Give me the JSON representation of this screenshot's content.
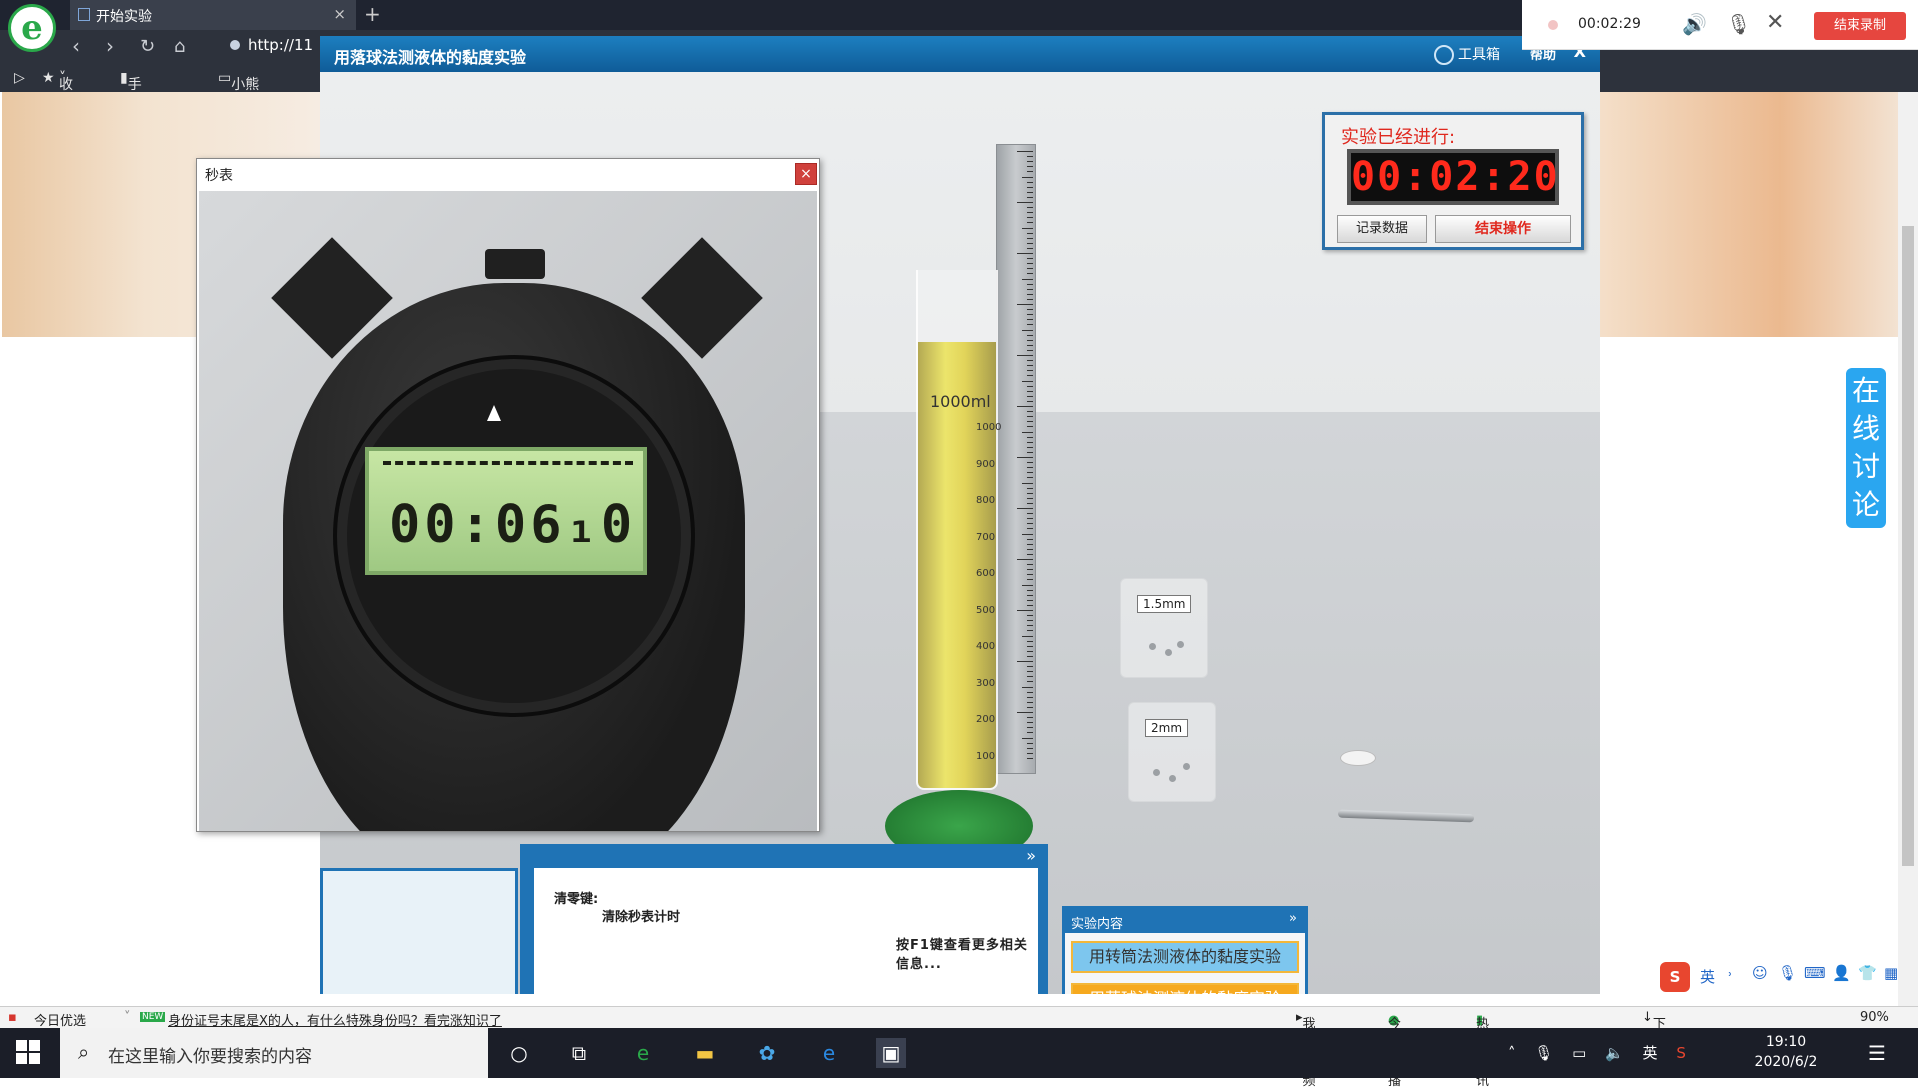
{
  "browser": {
    "tab_title": "开始实验",
    "address": "http://11",
    "bookmarks": [
      "收藏",
      "手机收藏夹",
      "小熊padd"
    ]
  },
  "app": {
    "title": "用落球法测液体的黏度实验",
    "toolbox_label": "工具箱",
    "help_label": "帮助",
    "close_label": "X"
  },
  "timer": {
    "label": "实验已经进行:",
    "display": "00:02:20",
    "record_button": "记录数据",
    "end_button": "结束操作"
  },
  "scene": {
    "cylinder_label": "1000ml",
    "cylinder_marks": [
      "1000",
      "900",
      "800",
      "700",
      "600",
      "500",
      "400",
      "300",
      "200",
      "100"
    ],
    "box1_label": "1.5mm",
    "box2_label": "2mm"
  },
  "stopwatch": {
    "title": "秒表",
    "close_label": "×",
    "display": "00:06₁0"
  },
  "info": {
    "key_label": "清零键:",
    "key_desc": "清除秒表计时",
    "hint": "按F1键查看更多相关信息..."
  },
  "content_panel": {
    "title": "实验内容",
    "items": [
      "用转筒法测液体的黏度实验",
      "用落球法测液体的黏度实验"
    ]
  },
  "discussion_label": "在线讨论",
  "recorder": {
    "time": "00:02:29",
    "end_label": "结束录制"
  },
  "status_bar": {
    "today_pick": "今日优选",
    "news": "身份证号末尾是X的人，有什么特殊身份吗？看完涨知识了",
    "my_video": "我的视频",
    "live": "今日直播",
    "hot": "热点资讯",
    "download": "下载",
    "zoom": "90%"
  },
  "taskbar": {
    "search_placeholder": "在这里输入你要搜索的内容",
    "time": "19:10",
    "date": "2020/6/2",
    "ime_lang": "英"
  }
}
